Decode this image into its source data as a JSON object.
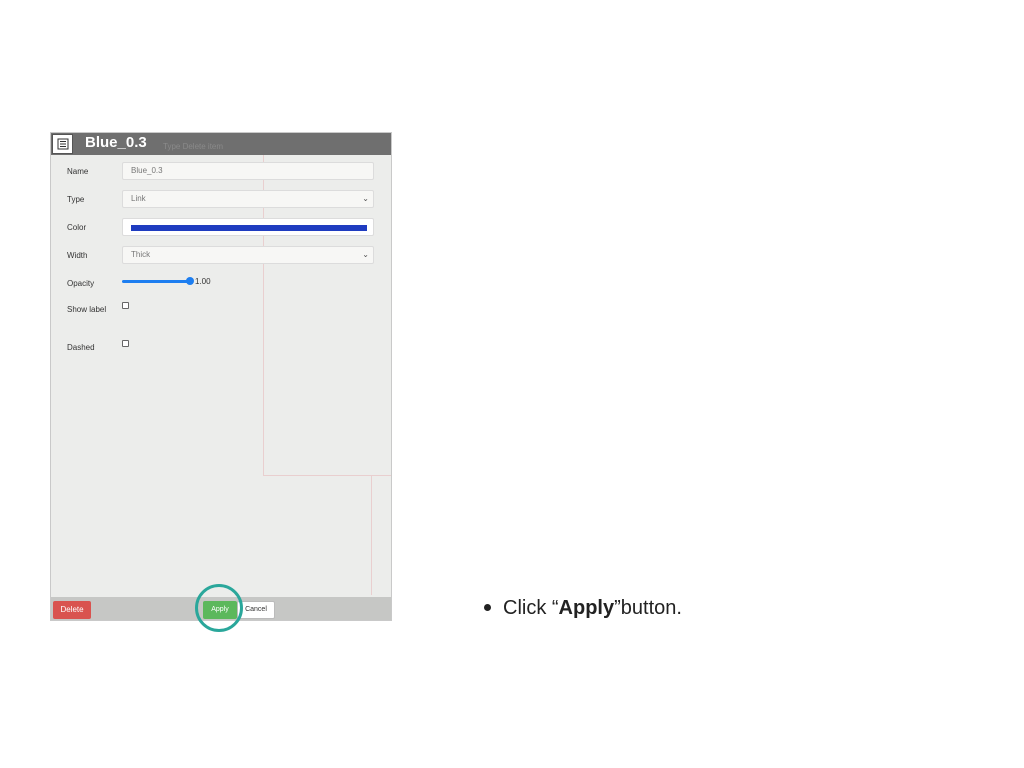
{
  "dialog": {
    "title": "Blue_0.3",
    "header_ghost_text": "Type   Delete item",
    "fields": {
      "name": {
        "label": "Name",
        "value": "Blue_0.3"
      },
      "type": {
        "label": "Type",
        "value": "Link"
      },
      "color": {
        "label": "Color",
        "value": "#1f3cc0"
      },
      "width": {
        "label": "Width",
        "value": "Thick"
      },
      "opacity": {
        "label": "Opacity",
        "value": "1.00",
        "level": 1.0
      },
      "show_label": {
        "label": "Show label",
        "checked": false
      },
      "dashed": {
        "label": "Dashed",
        "checked": false
      }
    },
    "buttons": {
      "delete": "Delete",
      "apply": "Apply",
      "cancel": "Cancel"
    }
  },
  "instruction": {
    "prefix": "Click “",
    "bold": "Apply",
    "suffix": "”button."
  },
  "colors": {
    "highlight": "#2aa79b",
    "apply": "#5cb85c",
    "delete": "#d9534f",
    "slider": "#1d7ef0",
    "header": "#6f6f6f"
  }
}
